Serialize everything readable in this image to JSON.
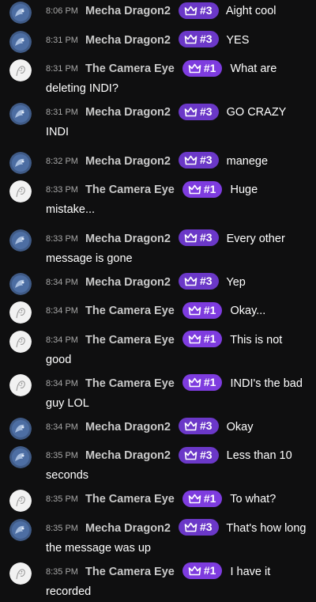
{
  "messages": [
    {
      "time": "8:06 PM",
      "author": "Mecha Dragon2",
      "badge": "#3",
      "text": "Aight cool"
    },
    {
      "time": "8:31 PM",
      "author": "Mecha Dragon2",
      "badge": "#3",
      "text": "YES"
    },
    {
      "time": "8:31 PM",
      "author": "The Camera Eye",
      "badge": "#1",
      "text": "What are deleting INDI?"
    },
    {
      "time": "8:31 PM",
      "author": "Mecha Dragon2",
      "badge": "#3",
      "text": "GO CRAZY INDI"
    },
    {
      "time": "8:32 PM",
      "author": "Mecha Dragon2",
      "badge": "#3",
      "text": "manege"
    },
    {
      "time": "8:33 PM",
      "author": "The Camera Eye",
      "badge": "#1",
      "text": "Huge mistake..."
    },
    {
      "time": "8:33 PM",
      "author": "Mecha Dragon2",
      "badge": "#3",
      "text": "Every other message is gone"
    },
    {
      "time": "8:34 PM",
      "author": "Mecha Dragon2",
      "badge": "#3",
      "text": "Yep"
    },
    {
      "time": "8:34 PM",
      "author": "The Camera Eye",
      "badge": "#1",
      "text": "Okay..."
    },
    {
      "time": "8:34 PM",
      "author": "The Camera Eye",
      "badge": "#1",
      "text": "This is not good"
    },
    {
      "time": "8:34 PM",
      "author": "The Camera Eye",
      "badge": "#1",
      "text": "INDI's the bad guy LOL"
    },
    {
      "time": "8:34 PM",
      "author": "Mecha Dragon2",
      "badge": "#3",
      "text": "Okay"
    },
    {
      "time": "8:35 PM",
      "author": "Mecha Dragon2",
      "badge": "#3",
      "text": "Less than 10 seconds"
    },
    {
      "time": "8:35 PM",
      "author": "The Camera Eye",
      "badge": "#1",
      "text": "To what?"
    },
    {
      "time": "8:35 PM",
      "author": "Mecha Dragon2",
      "badge": "#3",
      "text": "That's how long the message was up"
    },
    {
      "time": "8:35 PM",
      "author": "The Camera Eye",
      "badge": "#1",
      "text": "I have it recorded"
    }
  ],
  "colors": {
    "background": "#0f0f10",
    "badge_rank_3": "#6b38c8",
    "badge_rank_1": "#7e3cdf",
    "author": "#c9c9c9",
    "timestamp": "#a8a8a8"
  },
  "icons": {
    "badge": "crown-icon",
    "avatar_mecha": "blue-dragon-avatar",
    "avatar_camera": "white-sketch-avatar"
  }
}
